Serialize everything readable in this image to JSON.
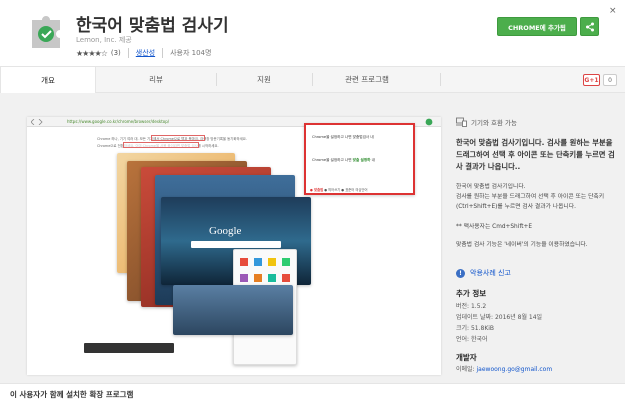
{
  "header": {
    "title": "한국어 맞춤법 검사기",
    "publisher": "Lemon, Inc. 제공",
    "rating_stars": "★★★★☆",
    "rating_count": "(3)",
    "category": "생산성",
    "users": "사용자 104명",
    "add_button": "CHROME에 추가됨",
    "close": "×",
    "share_icon": "share-icon",
    "colors": {
      "accent_green": "#4cae4c",
      "link_blue": "#1155cc",
      "gplus_red": "#dd4444"
    }
  },
  "tabs": [
    {
      "label": "개요",
      "active": true
    },
    {
      "label": "리뷰",
      "active": false
    },
    {
      "label": "지원",
      "active": false
    },
    {
      "label": "관련 프로그램",
      "active": false
    }
  ],
  "social": {
    "gplus_label": "G+1",
    "gplus_count": "0"
  },
  "screenshot": {
    "url": "https://www.google.co.kr/chrome/browser/desktop/",
    "text_line1": "Chrome 하나, 기기 여러 대. 모든 기기에서 Chrome으로 탭과 북마크, 검색창 방문기록을 동기화하세요.",
    "text_line2": "Chrome으로 전환하세요. 이미 Chrome을 사용 중이라면 맞춤법 검사를 시작하세요.",
    "popup": {
      "line1": "Chrome을 설정하고 나면 맞춤법검사 내",
      "line2_prefix": "Chrome을 설정하고 나면 ",
      "line2_em": "맞춤 설정하",
      "line2_suffix": " 내",
      "footer_label": "맞춤법",
      "footer_rest": "● 띄어쓰기 ● 표준어 의심단어"
    },
    "card_label": "Google"
  },
  "sidebar": {
    "compat": "기기와 호환 가능",
    "summary": "한국어 맞춤법 검사기입니다. 검사를 원하는 부분을 드래그하여 선택 후 아이콘 또는 단축키를 누르면 검사 결과가 나옵니다..",
    "desc1": "한국어 맞춤법 검사기입니다.",
    "desc2": "검사를 원하는 부분을 드래그하여 선택 후 아이콘 또는 단축키(Ctrl+Shift+E)를 누르면 검사 결과가 나옵니다.",
    "desc3": "** 맥사용자는 Cmd+Shift+E",
    "desc4": "맞춤법 검사 기능은 '네이버'의 기능을 이용하였습니다.",
    "report": "악용사례 신고",
    "info_title": "추가 정보",
    "version": "버전: 1.5.2",
    "updated": "업데이트 날짜: 2016년 8월 14일",
    "size": "크기: 51.8KiB",
    "language": "언어: 한국어",
    "dev_title": "개발자",
    "dev_email_label": "이메일:",
    "dev_email": "jaewoong.go@gmail.com"
  },
  "footer": {
    "related": "이 사용자가 함께 설치한 확장 프로그램"
  }
}
